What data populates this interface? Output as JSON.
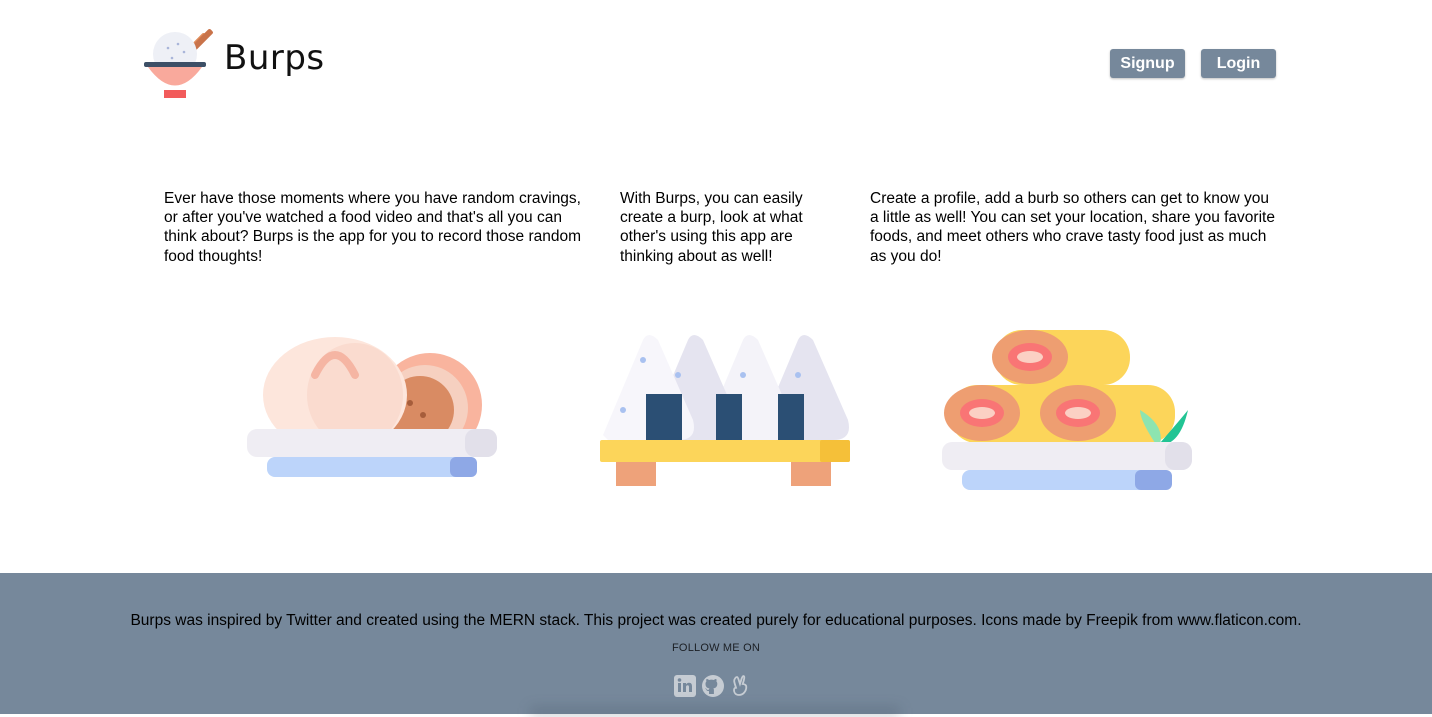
{
  "header": {
    "brand": "Burps",
    "logo_icon": "rice-bowl-chopsticks-icon",
    "signup_label": "Signup",
    "login_label": "Login"
  },
  "intro": [
    {
      "text": "Ever have those moments where you have random cravings, or after you've watched a food video and that's all you can think about? Burps is the app for you to record those random food thoughts!"
    },
    {
      "text": "With Burps, you can easily create a burp, look at what other's using this app are thinking about as well!"
    },
    {
      "text": "Create a profile, add a burb so others can get to know you a little as well! You can set your location, share you favorite foods, and meet others who crave tasty food just as much as you do!"
    }
  ],
  "illustrations": [
    "bao-plate-icon",
    "onigiri-board-icon",
    "egg-roll-plate-icon"
  ],
  "footer": {
    "credit": "Burps was inspired by Twitter and created using the MERN stack. This project was created purely for educational purposes. Icons made by Freepik from www.flaticon.com.",
    "follow_label": "FOLLOW ME ON",
    "socials": [
      "linkedin-icon",
      "github-icon",
      "angellist-icon"
    ]
  },
  "colors": {
    "accent": "#76889b",
    "background": "#ffffff"
  }
}
